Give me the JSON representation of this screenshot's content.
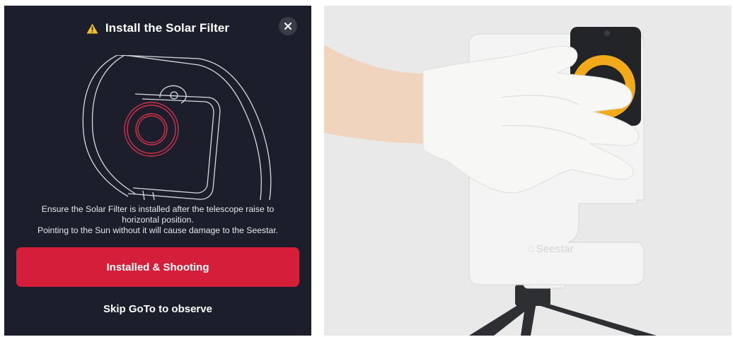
{
  "dialog": {
    "title": "Install the Solar Filter",
    "title_icon": "warning-icon",
    "close_icon": "close-icon",
    "message_lines": [
      "Ensure the Solar Filter is installed after the telescope raise to",
      "horizontal position.",
      "Pointing to the Sun without it will cause damage to the Seestar."
    ],
    "primary_button": "Installed & Shooting",
    "secondary_button": "Skip GoTo to observe",
    "colors": {
      "background": "#1c1f2b",
      "accent": "#d51f3a",
      "warning": "#f2c12e"
    }
  },
  "photo": {
    "brand_text": "☆Seestar",
    "colors": {
      "filter_ring": "#f2a91a",
      "glove": "#f7f7f5",
      "device": "#f4f4f4"
    }
  }
}
